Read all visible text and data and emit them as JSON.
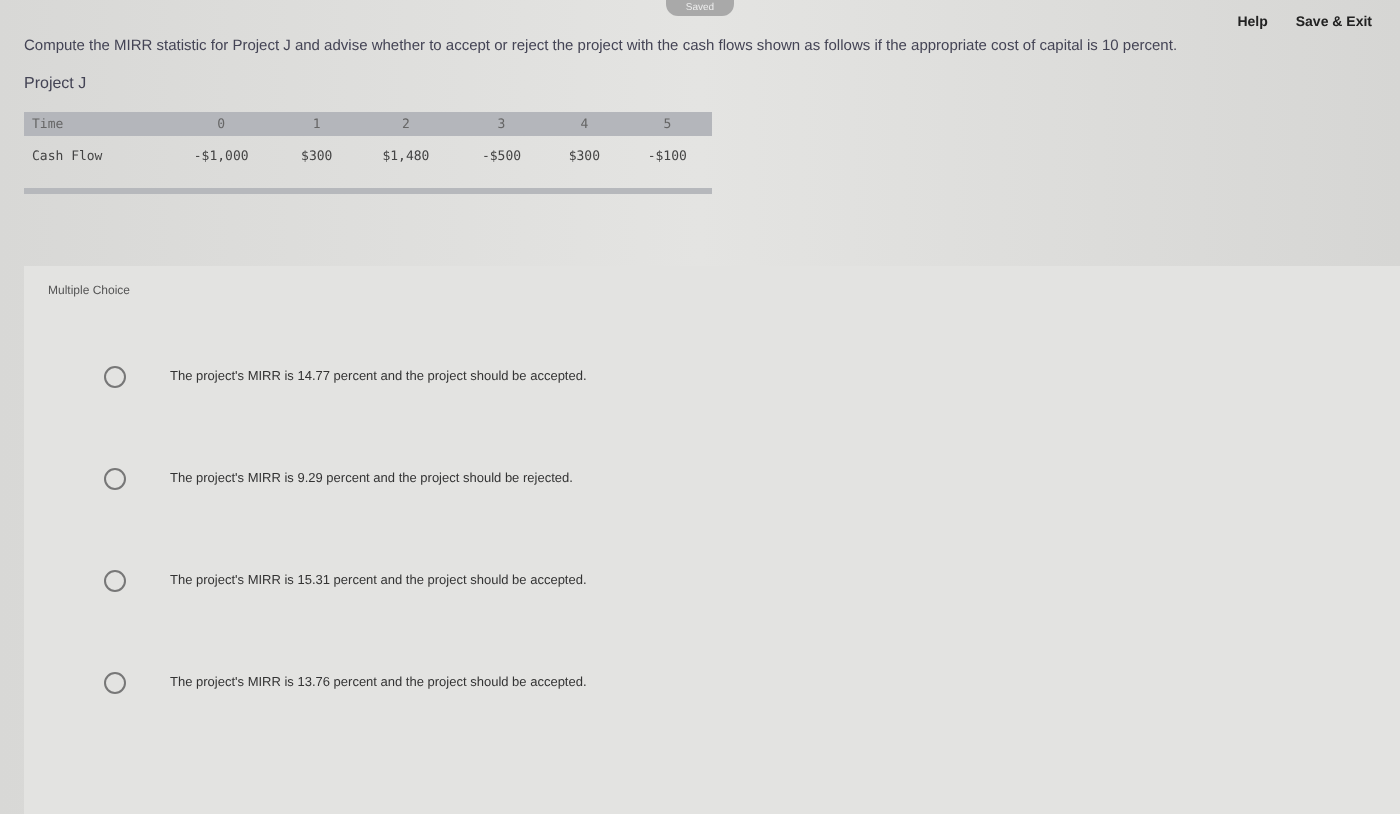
{
  "header": {
    "status": "Saved",
    "links": [
      "Help",
      "Save & Exit"
    ]
  },
  "question": "Compute the MIRR statistic for Project J and advise whether to accept or reject the project with the cash flows shown as follows if the appropriate cost of capital is 10 percent.",
  "project_label": "Project J",
  "table": {
    "columns": [
      "Time",
      "0",
      "1",
      "2",
      "3",
      "4",
      "5"
    ],
    "rows": [
      [
        "Cash Flow",
        "-$1,000",
        "$300",
        "$1,480",
        "-$500",
        "$300",
        "-$100"
      ]
    ]
  },
  "section_label": "Multiple Choice",
  "options": [
    {
      "text": "The project's MIRR is 14.77 percent and the project should be accepted.",
      "selected": false
    },
    {
      "text": "The project's MIRR is 9.29 percent and the project should be rejected.",
      "selected": false
    },
    {
      "text": "The project's MIRR is 15.31 percent and the project should be accepted.",
      "selected": false
    },
    {
      "text": "The project's MIRR is 13.76 percent and the project should be accepted.",
      "selected": false
    }
  ]
}
